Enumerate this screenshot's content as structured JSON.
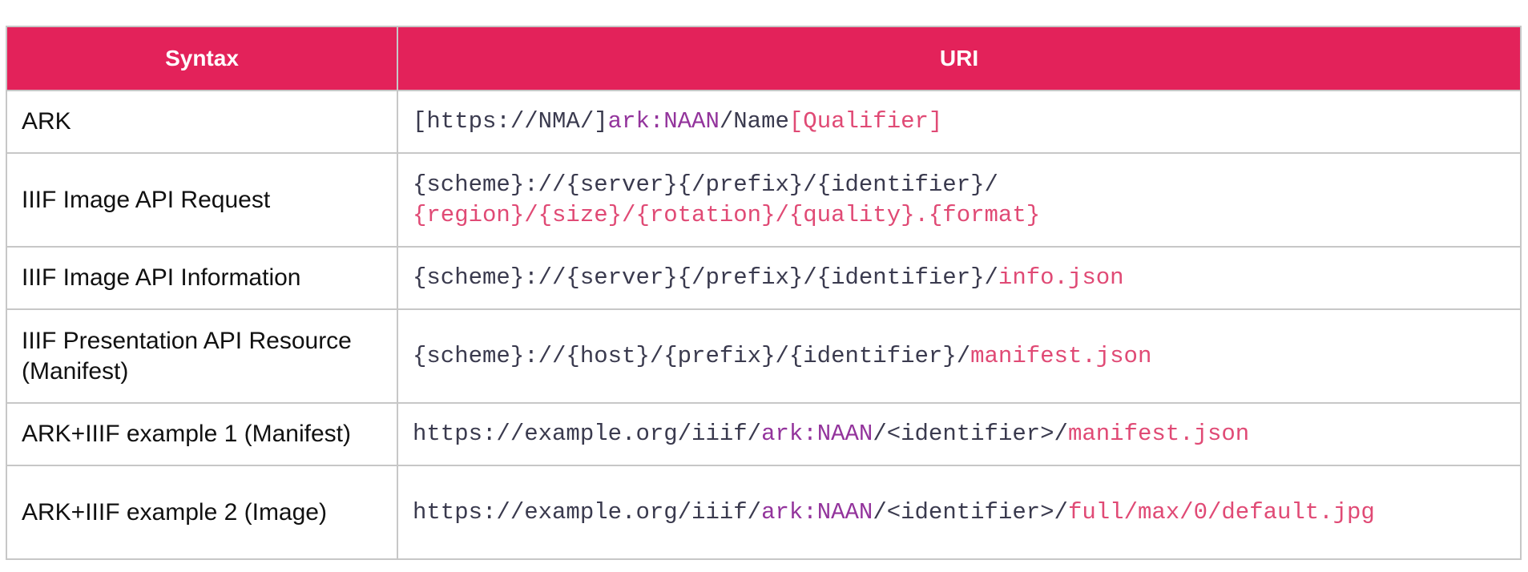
{
  "header": {
    "col_syntax": "Syntax",
    "col_uri": "URI"
  },
  "colors": {
    "header_bg": "#e3225a",
    "purple": "#93349c",
    "pink": "#e04a75",
    "dark_text": "#3a3a4e"
  },
  "rows": [
    {
      "syntax": "ARK",
      "uri": {
        "s0": "[https://NMA/]",
        "s1": "ark:NAAN",
        "s2": "/Name",
        "s3": "[Qualifier]"
      }
    },
    {
      "syntax": "IIIF Image API Request",
      "uri": {
        "line1": "{scheme}://{server}{/prefix}/{identifier}/",
        "line2": "{region}/{size}/{rotation}/{quality}.{format}"
      }
    },
    {
      "syntax": "IIIF Image API Information",
      "uri": {
        "s0": "{scheme}://{server}{/prefix}/{identifier}/",
        "s1": "info.json"
      }
    },
    {
      "syntax_line1": "IIIF Presentation API Resource",
      "syntax_line2": "(Manifest)",
      "uri": {
        "s0": "{scheme}://{host}/{prefix}/{identifier}/",
        "s1": "manifest.json"
      }
    },
    {
      "syntax": "ARK+IIIF example 1 (Manifest)",
      "uri": {
        "s0": "https://example.org/iiif/",
        "s1": "ark:NAAN",
        "s2": "/<identifier>/",
        "s3": "manifest.json"
      }
    },
    {
      "syntax": "ARK+IIIF example 2 (Image)",
      "uri": {
        "s0": "https://example.org/iiif/",
        "s1": "ark:NAAN",
        "s2": "/<identifier>/",
        "s3": "full/max/0/default.jpg"
      }
    }
  ]
}
